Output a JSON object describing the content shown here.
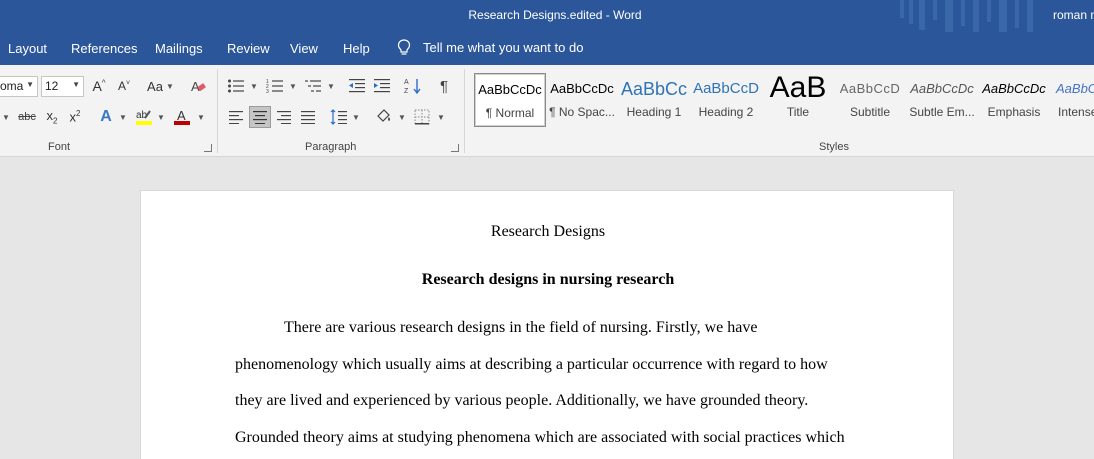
{
  "window": {
    "title": "Research Designs.edited  -  Word",
    "user": "roman m"
  },
  "tabs": [
    "Layout",
    "References",
    "Mailings",
    "Review",
    "View",
    "Help"
  ],
  "tellme": "Tell me what you want to do",
  "font": {
    "name": "oma",
    "size": "12",
    "group_label": "Font"
  },
  "paragraph": {
    "group_label": "Paragraph"
  },
  "styles": {
    "group_label": "Styles",
    "items": [
      {
        "sample": "AaBbCcDc",
        "name": "¶ Normal"
      },
      {
        "sample": "AaBbCcDc",
        "name": "¶ No Spac..."
      },
      {
        "sample": "AaBbCc",
        "name": "Heading 1"
      },
      {
        "sample": "AaBbCcD",
        "name": "Heading 2"
      },
      {
        "sample": "AaB",
        "name": "Title"
      },
      {
        "sample": "AaBbCcD",
        "name": "Subtitle"
      },
      {
        "sample": "AaBbCcDc",
        "name": "Subtle Em..."
      },
      {
        "sample": "AaBbCcDc",
        "name": "Emphasis"
      },
      {
        "sample": "AaBbC",
        "name": "Intense"
      }
    ]
  },
  "document": {
    "title": "Research Designs",
    "heading": "Research designs in nursing research",
    "lines": [
      "There are various research designs in the field of nursing. Firstly, we have",
      "phenomenology which usually aims at describing a particular occurrence with regard to how",
      "they are lived and experienced by various people. Additionally, we have grounded theory.",
      "Grounded theory aims at studying phenomena which are associated with social practices which"
    ]
  },
  "colors": {
    "brand": "#2b579a",
    "ribbon": "#f3f3f3",
    "canvas": "#e6e6e6"
  }
}
